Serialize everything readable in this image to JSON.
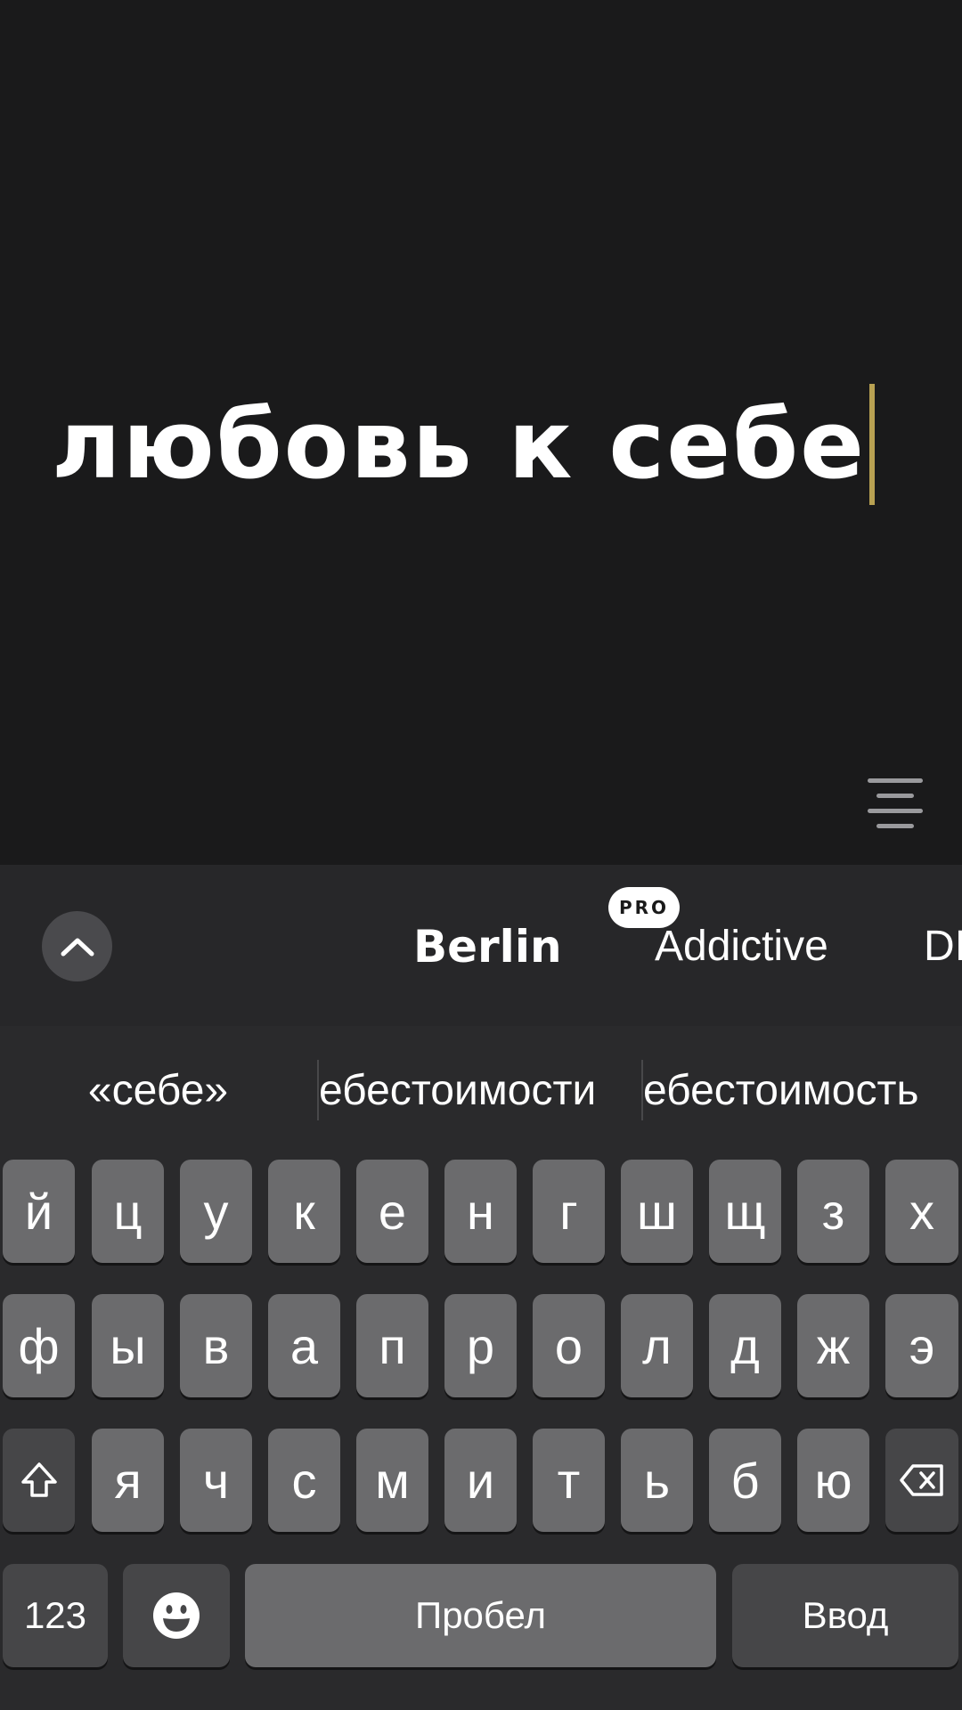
{
  "editor": {
    "headline": "любовь к себе",
    "caret_color": "#b8a152",
    "align_icon": "align-center-icon"
  },
  "font_bar": {
    "collapse_icon": "chevron-up-icon",
    "fonts": [
      {
        "name": "Berlin",
        "selected": true
      },
      {
        "name": "Addictive",
        "badge": "PRO"
      },
      {
        "name": "DI"
      }
    ]
  },
  "keyboard": {
    "suggestions": [
      "«себе»",
      "ебестоимости",
      "ебестоимость"
    ],
    "row1": [
      "й",
      "ц",
      "у",
      "к",
      "е",
      "н",
      "г",
      "ш",
      "щ",
      "з",
      "х"
    ],
    "row2": [
      "ф",
      "ы",
      "в",
      "а",
      "п",
      "р",
      "о",
      "л",
      "д",
      "ж",
      "э"
    ],
    "row3": [
      "я",
      "ч",
      "с",
      "м",
      "и",
      "т",
      "ь",
      "б",
      "ю"
    ],
    "shift_icon": "shift-icon",
    "backspace_icon": "backspace-icon",
    "numbers_label": "123",
    "emoji_icon": "emoji-icon",
    "space_label": "Пробел",
    "enter_label": "Ввод"
  }
}
